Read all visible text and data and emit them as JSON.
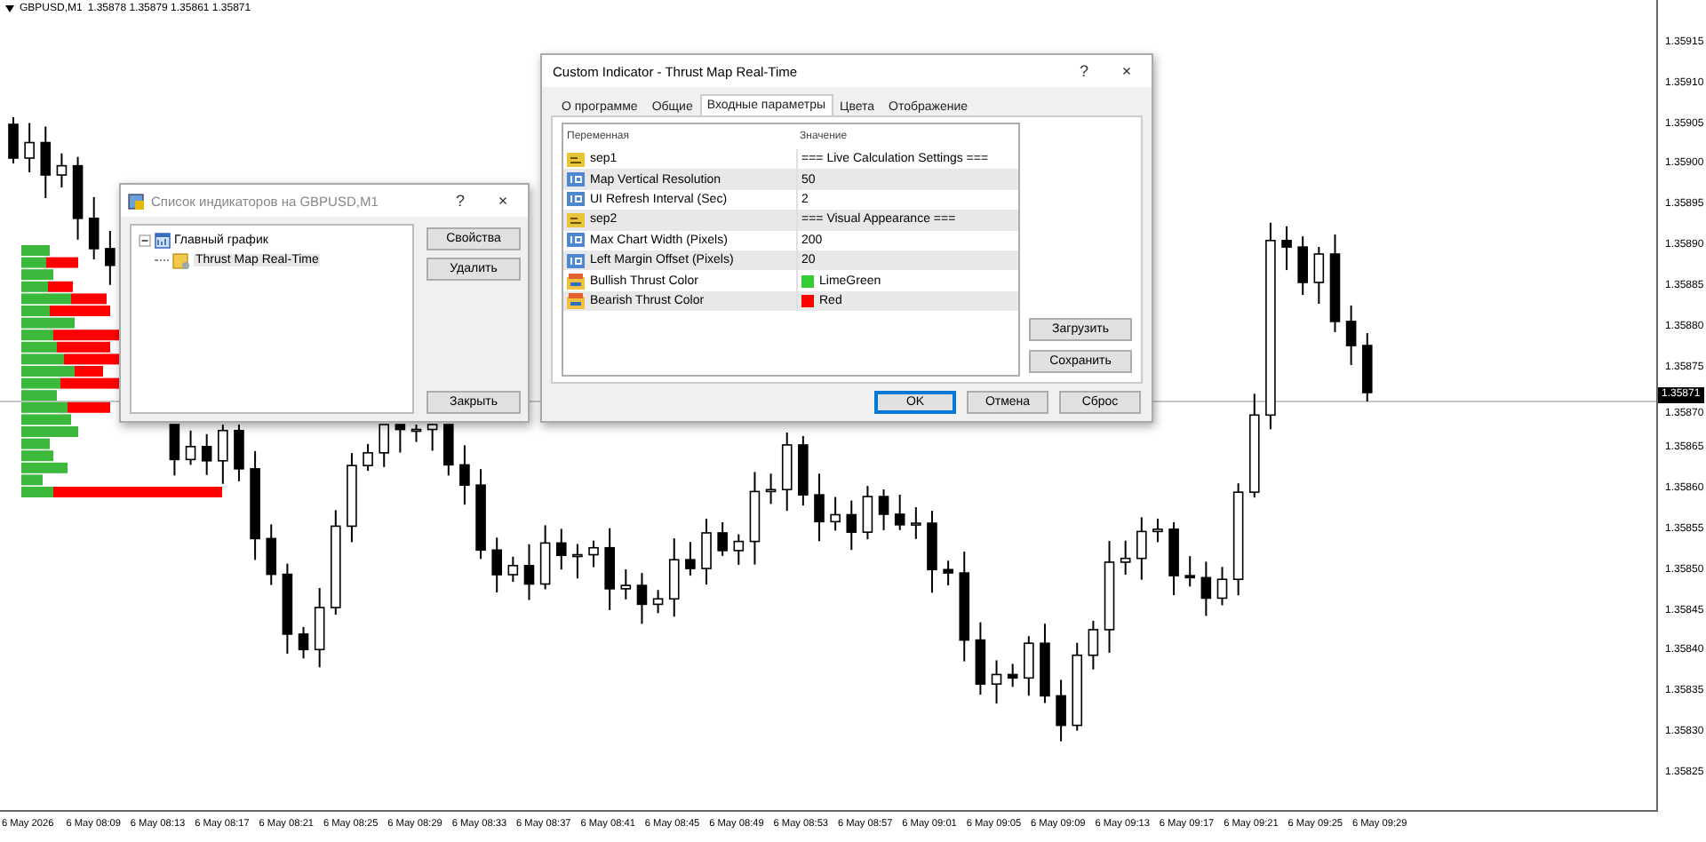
{
  "chart": {
    "symbol": "GBPUSD,M1",
    "ohlc": "1.35878 1.35879 1.35861 1.35871",
    "current_price": "1.35871",
    "price_labels": [
      "1.35915",
      "1.35910",
      "1.35905",
      "1.35900",
      "1.35895",
      "1.35890",
      "1.35885",
      "1.35880",
      "1.35875",
      "1.35870",
      "1.35865",
      "1.35860",
      "1.35855",
      "1.35850",
      "1.35845",
      "1.35840",
      "1.35835",
      "1.35830",
      "1.35825"
    ],
    "time_labels": [
      "6 May 2026",
      "6 May 08:09",
      "6 May 08:13",
      "6 May 08:17",
      "6 May 08:21",
      "6 May 08:25",
      "6 May 08:29",
      "6 May 08:33",
      "6 May 08:37",
      "6 May 08:41",
      "6 May 08:45",
      "6 May 08:49",
      "6 May 08:53",
      "6 May 08:57",
      "6 May 09:01",
      "6 May 09:05",
      "6 May 09:09",
      "6 May 09:13",
      "6 May 09:17",
      "6 May 09:21",
      "6 May 09:25",
      "6 May 09:29"
    ]
  },
  "indicator_list_dialog": {
    "title": "Список индикаторов на GBPUSD,M1",
    "help": "?",
    "close": "×",
    "tree": [
      {
        "label": "Главный график",
        "expanded": true,
        "children": [
          {
            "label": "Thrust Map Real-Time"
          }
        ]
      }
    ],
    "buttons": [
      "Свойства",
      "Удалить"
    ],
    "close_button": "Закрыть"
  },
  "indicator_dialog": {
    "title": "Custom Indicator - Thrust Map Real-Time",
    "help": "?",
    "close": "×",
    "tabs": [
      {
        "label": "О программе",
        "selected": false
      },
      {
        "label": "Общие",
        "selected": false
      },
      {
        "label": "Входные параметры",
        "selected": true
      },
      {
        "label": "Цвета",
        "selected": false
      },
      {
        "label": "Отображение",
        "selected": false
      }
    ],
    "columns": [
      "Переменная",
      "Значение"
    ],
    "params": [
      {
        "kind": "text",
        "name": "sep1",
        "value": "=== Live Calculation Settings ==="
      },
      {
        "kind": "number",
        "name": "Map Vertical Resolution",
        "value": "50"
      },
      {
        "kind": "number",
        "name": "UI Refresh Interval (Sec)",
        "value": "2"
      },
      {
        "kind": "text",
        "name": "sep2",
        "value": "=== Visual Appearance ==="
      },
      {
        "kind": "number",
        "name": "Max Chart Width (Pixels)",
        "value": "200"
      },
      {
        "kind": "number",
        "name": "Left Margin Offset (Pixels)",
        "value": "20"
      },
      {
        "kind": "color",
        "name": "Bullish Thrust Color",
        "value": "LimeGreen",
        "color": "#32cd32"
      },
      {
        "kind": "color",
        "name": "Bearish Thrust Color",
        "value": "Red",
        "color": "#ff0000"
      }
    ],
    "side_buttons": [
      "Загрузить",
      "Сохранить"
    ],
    "buttons": [
      {
        "label": "OK",
        "default": true
      },
      {
        "label": "Отмена",
        "default": false
      },
      {
        "label": "Сброс",
        "default": false
      }
    ]
  }
}
